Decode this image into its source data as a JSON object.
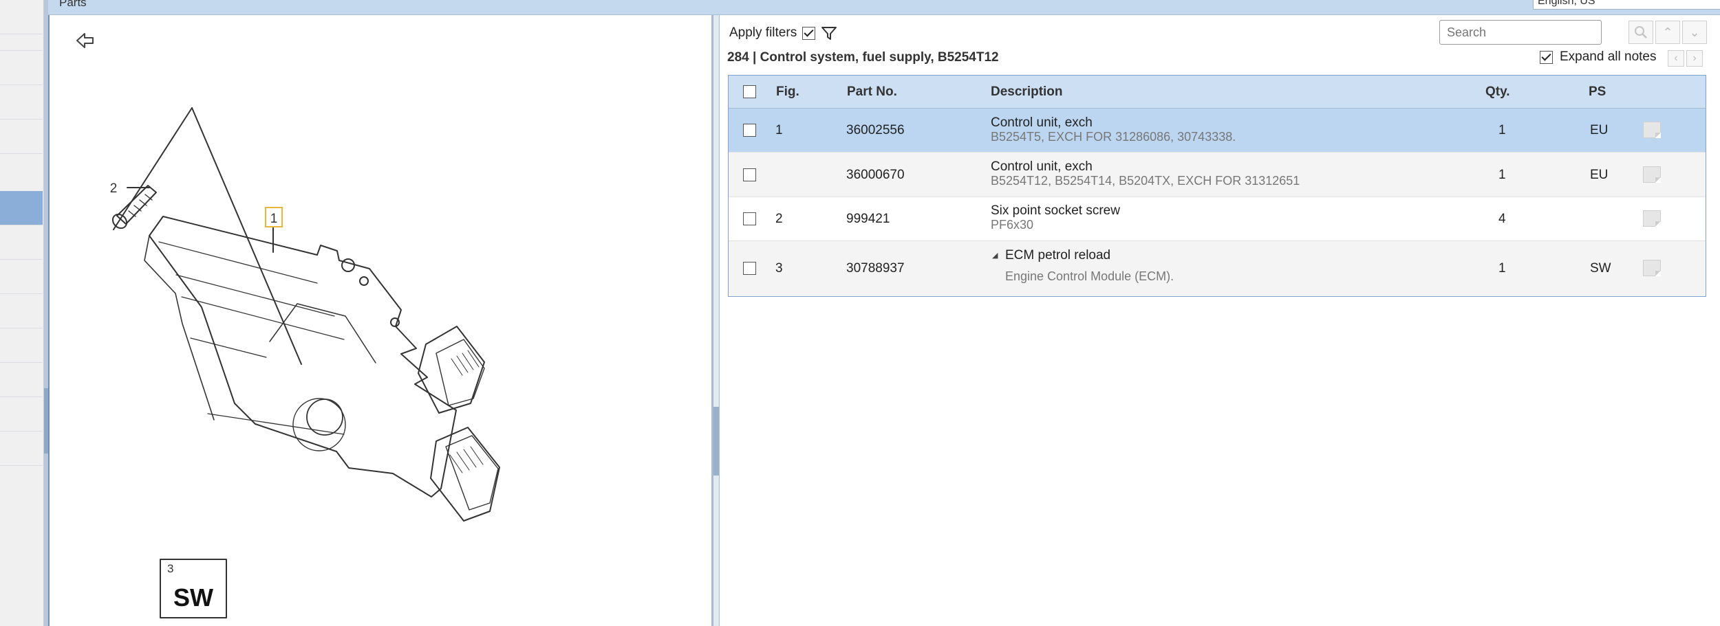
{
  "app": {
    "panel_title": "Parts",
    "language": "English, US"
  },
  "drawing": {
    "callout_1": "1",
    "callout_2": "2",
    "sw_box_number": "3",
    "sw_box_label": "SW"
  },
  "filters": {
    "apply_label": "Apply filters",
    "apply_checked": true,
    "search_placeholder": "Search",
    "expand_label": "Expand all notes",
    "expand_checked": true
  },
  "section": {
    "title": "284  |  Control system, fuel supply, B5254T12"
  },
  "table": {
    "headers": {
      "fig": "Fig.",
      "part_no": "Part No.",
      "description": "Description",
      "qty": "Qty.",
      "ps": "PS"
    },
    "rows": [
      {
        "fig": "1",
        "part_no": "36002556",
        "desc": "Control unit, exch",
        "note": "B5254T5, EXCH FOR 31286086, 30743338.",
        "qty": "1",
        "ps": "EU",
        "selected": true
      },
      {
        "fig": "",
        "part_no": "36000670",
        "desc": "Control unit, exch",
        "note": "B5254T12, B5254T14, B5204TX, EXCH FOR 31312651",
        "qty": "1",
        "ps": "EU",
        "selected": false
      },
      {
        "fig": "2",
        "part_no": "999421",
        "desc": "Six point socket screw",
        "note": "PF6x30",
        "qty": "4",
        "ps": "",
        "selected": false
      },
      {
        "fig": "3",
        "part_no": "30788937",
        "desc": "ECM petrol reload",
        "expand_arrow": "◢",
        "note": "Engine Control Module (ECM).",
        "qty": "1",
        "ps": "SW",
        "selected": false
      }
    ]
  }
}
